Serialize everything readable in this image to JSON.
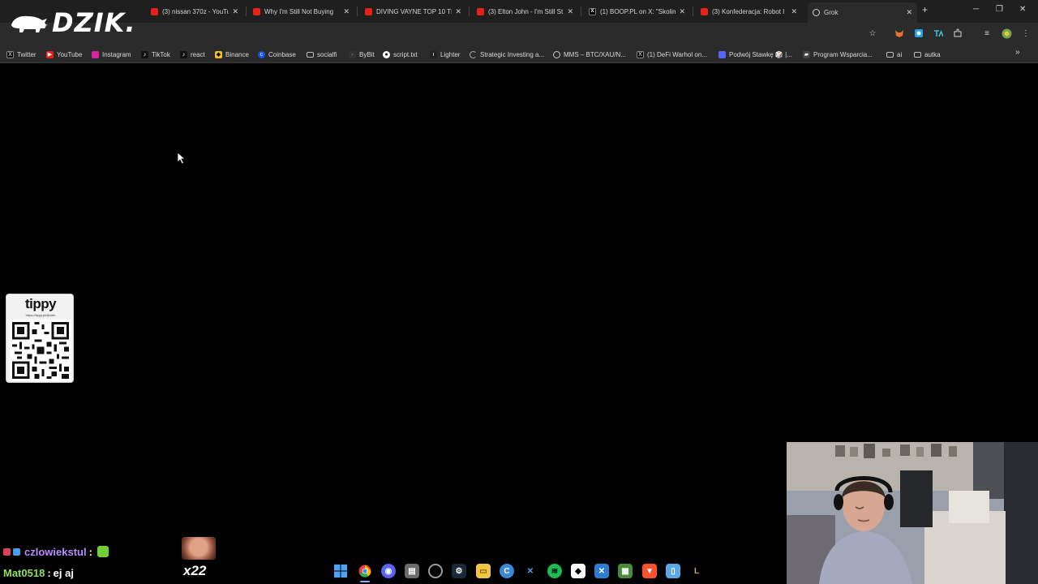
{
  "browser": {
    "tabs": [
      {
        "title": "(3) nissan 370z - YouTube",
        "icon": "youtube-icon"
      },
      {
        "title": "Why I'm Still Not Buying",
        "icon": "youtube-icon"
      },
      {
        "title": "DIVING VAYNE TOP 10 TI",
        "icon": "youtube-icon"
      },
      {
        "title": "(3) Elton John - I'm Still St",
        "icon": "youtube-icon"
      },
      {
        "title": "(1) BOOP.PL on X: \"Skolim",
        "icon": "x-icon"
      },
      {
        "title": "(3) Konfederacja: Robot I",
        "icon": "youtube-icon"
      },
      {
        "title": "Grok",
        "icon": "grok-icon",
        "active": true
      }
    ],
    "new_tab_label": "+",
    "bookmarks": [
      {
        "label": "Twitter",
        "icon": "x-icon",
        "color": "#000000"
      },
      {
        "label": "YouTube",
        "icon": "youtube-icon",
        "color": "#e62117"
      },
      {
        "label": "Instagram",
        "icon": "instagram-icon",
        "color": "#d6249f"
      },
      {
        "label": "TikTok",
        "icon": "tiktok-icon",
        "color": "#111111"
      },
      {
        "label": "react",
        "icon": "tiktok-icon",
        "color": "#111111"
      },
      {
        "label": "Binance",
        "icon": "binance-icon",
        "color": "#f3ba2f"
      },
      {
        "label": "Coinbase",
        "icon": "coinbase-icon",
        "color": "#1652f0"
      },
      {
        "label": "socialfi",
        "icon": "folder-icon",
        "color": ""
      },
      {
        "label": "ByBit",
        "icon": "bybit-icon",
        "color": "#333333"
      },
      {
        "label": "script.txt",
        "icon": "github-icon",
        "color": "#ffffff"
      },
      {
        "label": "Lighter",
        "icon": "lighter-icon",
        "color": "#222222"
      },
      {
        "label": "Strategic Investing a...",
        "icon": "loading-icon",
        "color": ""
      },
      {
        "label": "MMS – BTC/XAU/N...",
        "icon": "globe-icon",
        "color": ""
      },
      {
        "label": "(1) DeFi Warhol on...",
        "icon": "x-icon",
        "color": "#000000"
      },
      {
        "label": "Podwój Stawkę 🎲 |...",
        "icon": "discord-icon",
        "color": "#5865f2"
      },
      {
        "label": "Program Wsparcia...",
        "icon": "tag-icon",
        "color": "#444444"
      },
      {
        "label": "ai",
        "icon": "folder-icon",
        "color": ""
      },
      {
        "label": "autka",
        "icon": "folder-icon",
        "color": ""
      }
    ],
    "overflow_label": "»"
  },
  "overlay": {
    "logo_text": "DZIK.",
    "tippy": {
      "brand": "tippy",
      "url": "https://tippy.pl/@dzik"
    }
  },
  "chat": {
    "messages": [
      {
        "user": "czlowiekstul",
        "separator": ":",
        "text": ""
      },
      {
        "user": "Mat0518",
        "separator": ":",
        "text": "ej aj"
      }
    ],
    "emote_caption": "x22"
  },
  "taskbar": {
    "icons": [
      {
        "name": "windows-start-icon",
        "color": "#4fa3f7"
      },
      {
        "name": "chrome-icon",
        "color": "#e94235"
      },
      {
        "name": "discord-icon",
        "color": "#5865f2"
      },
      {
        "name": "clipboard-icon",
        "color": "#6b6b6b"
      },
      {
        "name": "settings-icon",
        "color": "#7a7a7a"
      },
      {
        "name": "steam-icon",
        "color": "#1b2838"
      },
      {
        "name": "file-explorer-icon",
        "color": "#f4c542"
      },
      {
        "name": "ccleaner-icon",
        "color": "#3b88d6"
      },
      {
        "name": "network-icon",
        "color": "#4fa3f7"
      },
      {
        "name": "spotify-icon",
        "color": "#1db954"
      },
      {
        "name": "messenger-icon",
        "color": "#ffffff"
      },
      {
        "name": "vscode-icon",
        "color": "#2d7dd2"
      },
      {
        "name": "terminal-icon",
        "color": "#4a8a3a"
      },
      {
        "name": "brave-icon",
        "color": "#fb542b"
      },
      {
        "name": "notepad-icon",
        "color": "#5aa9e6"
      },
      {
        "name": "league-icon",
        "color": "#c8aa6e"
      }
    ]
  }
}
